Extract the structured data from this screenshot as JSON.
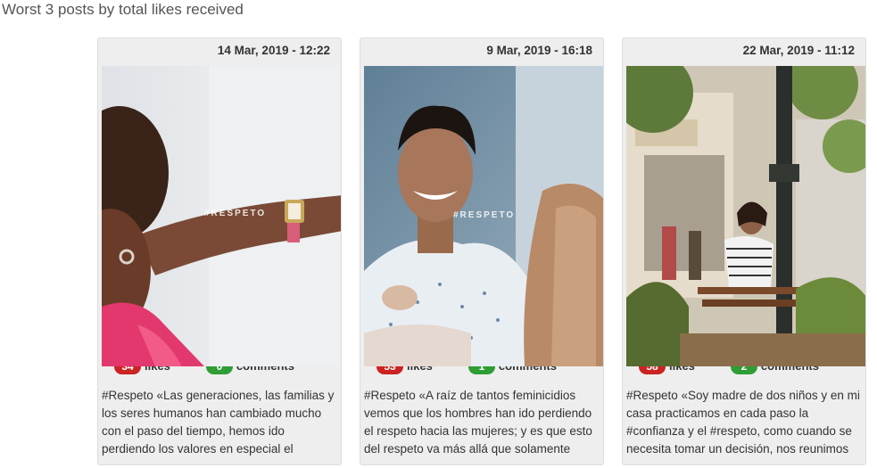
{
  "heading": "Worst 3 posts by total likes received",
  "stat_labels": {
    "likes": "likes",
    "comments": "comments"
  },
  "posts": [
    {
      "date": "14 Mar, 2019 - 12:22",
      "likes": "34",
      "comments": "0",
      "overlay_text": "#RESPETO",
      "caption": "#Respeto «Las generaciones, las familias y los seres humanos han cambiado mucho con el paso del tiempo, hemos ido perdiendo los valores en especial el"
    },
    {
      "date": "9 Mar, 2019 - 16:18",
      "likes": "53",
      "comments": "1",
      "overlay_text": "#RESPETO",
      "caption": "#Respeto «A raíz de tantos feminicidios vemos que los hombres han ido perdiendo el respeto hacia las mujeres; y es que esto del respeto va más allá que solamente"
    },
    {
      "date": "22 Mar, 2019 - 11:12",
      "likes": "58",
      "comments": "2",
      "overlay_text": "",
      "caption": "#Respeto «Soy madre de dos niños y en mi casa practicamos en cada paso la #confianza y el #respeto, como cuando se necesita tomar un decisión, nos reunimos"
    }
  ],
  "colors": {
    "likes_badge": "#cc2222",
    "comments_badge": "#2e9e34",
    "card_bg": "#eeeeee"
  }
}
